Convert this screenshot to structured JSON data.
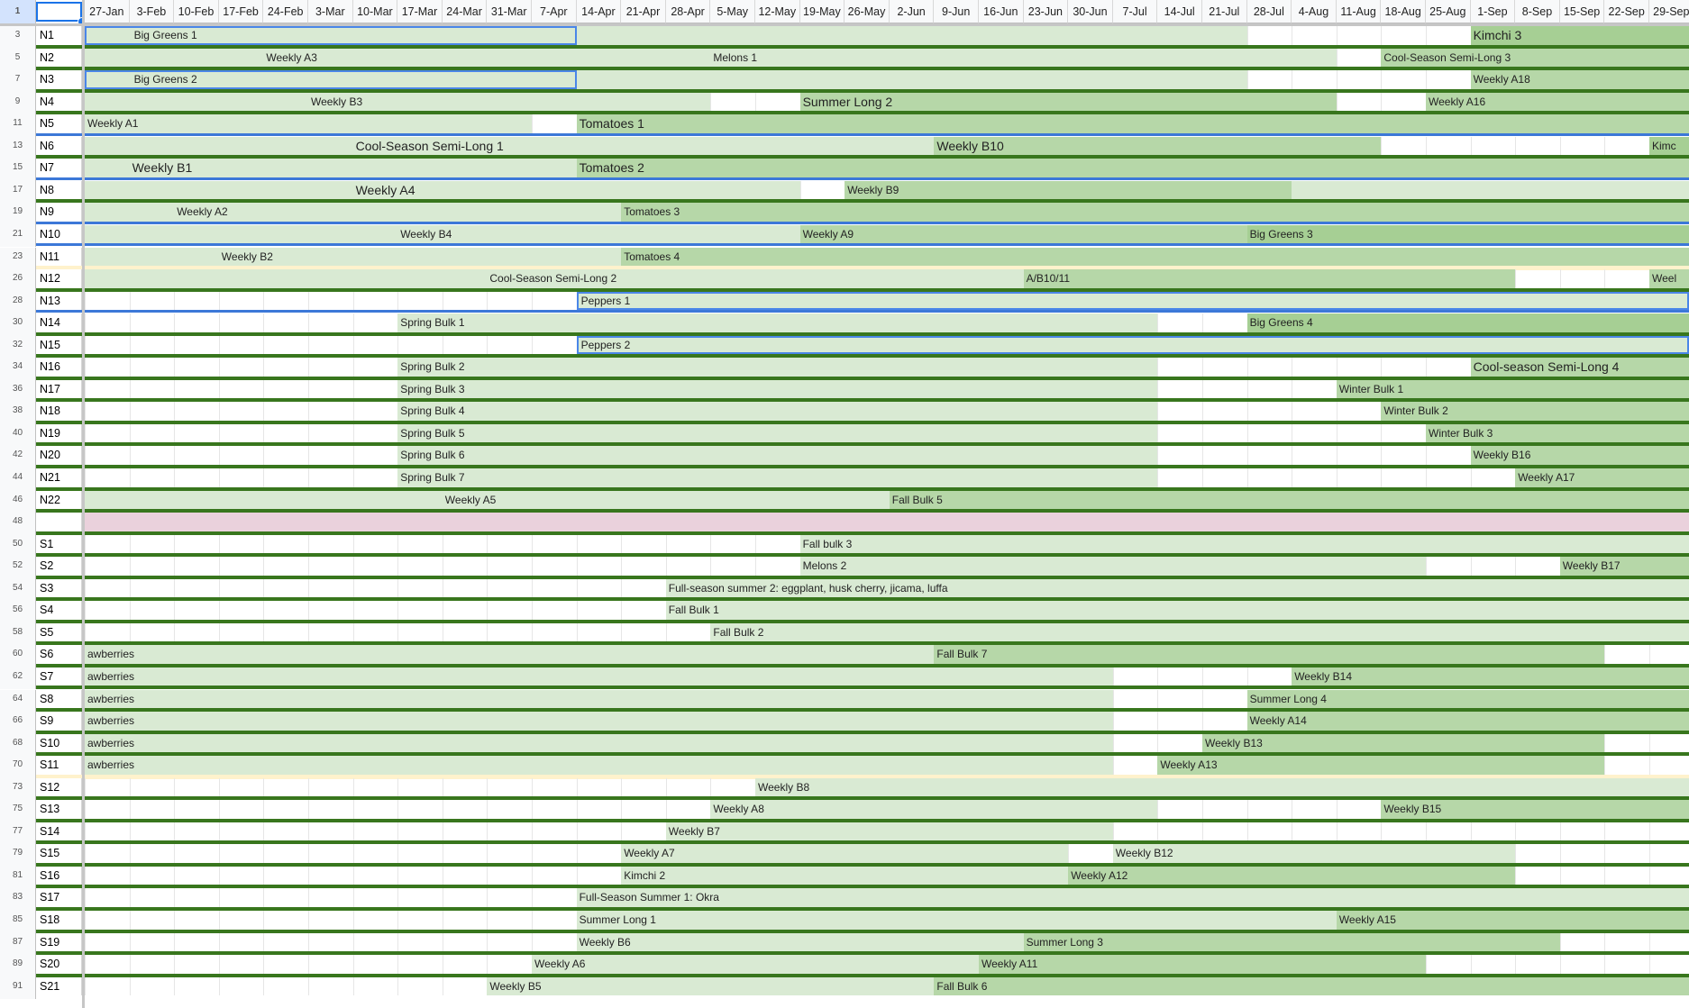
{
  "sheet": {
    "selected_row_number": "1",
    "columns": [
      "27-Jan",
      "3-Feb",
      "10-Feb",
      "17-Feb",
      "24-Feb",
      "3-Mar",
      "10-Mar",
      "17-Mar",
      "24-Mar",
      "31-Mar",
      "7-Apr",
      "14-Apr",
      "21-Apr",
      "28-Apr",
      "5-May",
      "12-May",
      "19-May",
      "26-May",
      "2-Jun",
      "9-Jun",
      "16-Jun",
      "23-Jun",
      "30-Jun",
      "7-Jul",
      "14-Jul",
      "21-Jul",
      "28-Jul",
      "4-Aug",
      "11-Aug",
      "18-Aug",
      "25-Aug",
      "1-Sep",
      "8-Sep",
      "15-Sep",
      "22-Sep",
      "29-Sep"
    ],
    "colors": {
      "light": "#d9ead3",
      "mid": "#b6d7a8",
      "dark": "#a6cf94",
      "separator_green": "#38761d",
      "separator_blue": "#3c78d8",
      "outline_blue": "#4a86e8",
      "pink_row": "#ead1dc",
      "selection_blue": "#1a73e8"
    },
    "rows": [
      {
        "num": "3",
        "label": "N1",
        "sep": "green",
        "segs": [
          {
            "s": 0,
            "e": 11,
            "t": "Big Greens 1",
            "c": "light",
            "o": true,
            "i": 1
          },
          {
            "s": 11,
            "e": 26,
            "t": "",
            "c": "light"
          },
          {
            "s": 31,
            "e": 36,
            "t": "Kimchi 3",
            "c": "dark",
            "big": true
          }
        ]
      },
      {
        "num": "5",
        "label": "N2",
        "sep": "green",
        "segs": [
          {
            "s": 0,
            "e": 14,
            "t": "Weekly A3",
            "c": "light",
            "i": 4
          },
          {
            "s": 14,
            "e": 28,
            "t": "Melons 1",
            "c": "light"
          },
          {
            "s": 29,
            "e": 36,
            "t": "Cool-Season Semi-Long 3",
            "c": "mid"
          }
        ]
      },
      {
        "num": "7",
        "label": "N3",
        "sep": "green",
        "segs": [
          {
            "s": 0,
            "e": 11,
            "t": "Big Greens 2",
            "c": "light",
            "o": true,
            "i": 1
          },
          {
            "s": 11,
            "e": 26,
            "t": "",
            "c": "light"
          },
          {
            "s": 31,
            "e": 36,
            "t": "Weekly A18",
            "c": "mid"
          }
        ]
      },
      {
        "num": "9",
        "label": "N4",
        "sep": "green",
        "segs": [
          {
            "s": 0,
            "e": 14,
            "t": "Weekly B3",
            "c": "light",
            "i": 5
          },
          {
            "s": 16,
            "e": 28,
            "t": "Summer Long 2",
            "c": "mid",
            "big": true
          },
          {
            "s": 30,
            "e": 36,
            "t": "Weekly A16",
            "c": "mid"
          }
        ]
      },
      {
        "num": "11",
        "label": "N5",
        "sep": "blue",
        "segs": [
          {
            "s": 0,
            "e": 10,
            "t": "Weekly A1",
            "c": "light"
          },
          {
            "s": 11,
            "e": 36,
            "t": "Tomatoes 1",
            "c": "mid",
            "big": true
          }
        ]
      },
      {
        "num": "13",
        "label": "N6",
        "sep": "green",
        "segs": [
          {
            "s": 0,
            "e": 19,
            "t": "Cool-Season Semi-Long 1",
            "c": "light",
            "big": true,
            "i": 6
          },
          {
            "s": 19,
            "e": 29,
            "t": "Weekly B10",
            "c": "mid",
            "big": true
          },
          {
            "s": 35,
            "e": 36,
            "t": "Kimc",
            "c": "dark"
          }
        ]
      },
      {
        "num": "15",
        "label": "N7",
        "sep": "blue",
        "segs": [
          {
            "s": 0,
            "e": 11,
            "t": "Weekly B1",
            "c": "light",
            "big": true,
            "i": 1
          },
          {
            "s": 11,
            "e": 36,
            "t": "Tomatoes 2",
            "c": "mid",
            "big": true
          }
        ]
      },
      {
        "num": "17",
        "label": "N8",
        "sep": "green",
        "segs": [
          {
            "s": 0,
            "e": 16,
            "t": "Weekly A4",
            "c": "light",
            "big": true,
            "i": 6
          },
          {
            "s": 17,
            "e": 27,
            "t": "Weekly B9",
            "c": "mid"
          },
          {
            "s": 27,
            "e": 36,
            "t": "",
            "c": "light"
          }
        ]
      },
      {
        "num": "19",
        "label": "N9",
        "sep": "blue",
        "segs": [
          {
            "s": 0,
            "e": 12,
            "t": "Weekly A2",
            "c": "light",
            "i": 2
          },
          {
            "s": 12,
            "e": 36,
            "t": "Tomatoes 3",
            "c": "mid"
          }
        ]
      },
      {
        "num": "21",
        "label": "N10",
        "sep": "blue",
        "segs": [
          {
            "s": 0,
            "e": 16,
            "t": "Weekly B4",
            "c": "light",
            "i": 7
          },
          {
            "s": 16,
            "e": 26,
            "t": "Weekly A9",
            "c": "mid"
          },
          {
            "s": 26,
            "e": 36,
            "t": "Big Greens 3",
            "c": "dark"
          }
        ]
      },
      {
        "num": "23",
        "label": "N11",
        "sep": "thin",
        "segs": [
          {
            "s": 0,
            "e": 12,
            "t": "Weekly B2",
            "c": "light",
            "i": 3
          },
          {
            "s": 12,
            "e": 36,
            "t": "Tomatoes 4",
            "c": "mid"
          }
        ]
      },
      {
        "num": "26",
        "label": "N12",
        "sep": "green",
        "segs": [
          {
            "s": 0,
            "e": 21,
            "t": "Cool-Season Semi-Long 2",
            "c": "light",
            "i": 9
          },
          {
            "s": 21,
            "e": 32,
            "t": "A/B10/11",
            "c": "mid"
          },
          {
            "s": 35,
            "e": 36,
            "t": "Weel",
            "c": "mid"
          }
        ]
      },
      {
        "num": "28",
        "label": "N13",
        "sep": "blue",
        "segs": [
          {
            "s": 11,
            "e": 36,
            "t": "Peppers 1",
            "c": "light",
            "o": true
          }
        ]
      },
      {
        "num": "30",
        "label": "N14",
        "sep": "green",
        "segs": [
          {
            "s": 7,
            "e": 24,
            "t": "Spring Bulk 1",
            "c": "light"
          },
          {
            "s": 26,
            "e": 36,
            "t": "Big Greens 4",
            "c": "dark"
          }
        ]
      },
      {
        "num": "32",
        "label": "N15",
        "sep": "green",
        "segs": [
          {
            "s": 11,
            "e": 36,
            "t": "Peppers 2",
            "c": "light",
            "o": true
          }
        ]
      },
      {
        "num": "34",
        "label": "N16",
        "sep": "green",
        "segs": [
          {
            "s": 7,
            "e": 24,
            "t": "Spring Bulk 2",
            "c": "light"
          },
          {
            "s": 31,
            "e": 36,
            "t": "Cool-season Semi-Long 4",
            "c": "mid",
            "big": true
          }
        ]
      },
      {
        "num": "36",
        "label": "N17",
        "sep": "green",
        "segs": [
          {
            "s": 7,
            "e": 24,
            "t": "Spring Bulk 3",
            "c": "light"
          },
          {
            "s": 28,
            "e": 36,
            "t": "Winter Bulk 1",
            "c": "mid"
          }
        ]
      },
      {
        "num": "38",
        "label": "N18",
        "sep": "green",
        "segs": [
          {
            "s": 7,
            "e": 24,
            "t": "Spring Bulk 4",
            "c": "light"
          },
          {
            "s": 29,
            "e": 36,
            "t": "Winter Bulk 2",
            "c": "mid"
          }
        ]
      },
      {
        "num": "40",
        "label": "N19",
        "sep": "green",
        "segs": [
          {
            "s": 7,
            "e": 24,
            "t": "Spring Bulk 5",
            "c": "light"
          },
          {
            "s": 30,
            "e": 36,
            "t": "Winter Bulk 3",
            "c": "mid"
          }
        ]
      },
      {
        "num": "42",
        "label": "N20",
        "sep": "green",
        "segs": [
          {
            "s": 7,
            "e": 24,
            "t": "Spring Bulk 6",
            "c": "light"
          },
          {
            "s": 31,
            "e": 36,
            "t": "Weekly B16",
            "c": "mid"
          }
        ]
      },
      {
        "num": "44",
        "label": "N21",
        "sep": "green",
        "segs": [
          {
            "s": 7,
            "e": 24,
            "t": "Spring Bulk 7",
            "c": "light"
          },
          {
            "s": 32,
            "e": 36,
            "t": "Weekly A17",
            "c": "mid"
          }
        ]
      },
      {
        "num": "46",
        "label": "N22",
        "sep": "green",
        "segs": [
          {
            "s": 0,
            "e": 18,
            "t": "Weekly A5",
            "c": "light",
            "i": 8
          },
          {
            "s": 18,
            "e": 36,
            "t": "Fall Bulk 5",
            "c": "mid"
          }
        ]
      },
      {
        "num": "48",
        "label": "",
        "sep": "green",
        "pink": true,
        "segs": []
      },
      {
        "num": "50",
        "label": "S1",
        "sep": "green",
        "segs": [
          {
            "s": 16,
            "e": 36,
            "t": "Fall bulk 3",
            "c": "light"
          }
        ]
      },
      {
        "num": "52",
        "label": "S2",
        "sep": "green",
        "segs": [
          {
            "s": 16,
            "e": 30,
            "t": "Melons 2",
            "c": "light"
          },
          {
            "s": 33,
            "e": 36,
            "t": "Weekly B17",
            "c": "mid"
          }
        ]
      },
      {
        "num": "54",
        "label": "S3",
        "sep": "green",
        "segs": [
          {
            "s": 13,
            "e": 36,
            "t": "Full-season summer 2: eggplant, husk cherry, jicama, luffa",
            "c": "light"
          }
        ]
      },
      {
        "num": "56",
        "label": "S4",
        "sep": "green",
        "segs": [
          {
            "s": 13,
            "e": 36,
            "t": "Fall Bulk 1",
            "c": "light"
          }
        ]
      },
      {
        "num": "58",
        "label": "S5",
        "sep": "green",
        "segs": [
          {
            "s": 14,
            "e": 36,
            "t": "Fall Bulk 2",
            "c": "light"
          }
        ]
      },
      {
        "num": "60",
        "label": "S6",
        "sep": "green",
        "segs": [
          {
            "s": 0,
            "e": 19,
            "t": "awberries",
            "c": "light"
          },
          {
            "s": 19,
            "e": 34,
            "t": "Fall Bulk 7",
            "c": "mid"
          }
        ]
      },
      {
        "num": "62",
        "label": "S7",
        "sep": "green",
        "segs": [
          {
            "s": 0,
            "e": 23,
            "t": "awberries",
            "c": "light"
          },
          {
            "s": 27,
            "e": 36,
            "t": "Weekly B14",
            "c": "mid"
          }
        ]
      },
      {
        "num": "64",
        "label": "S8",
        "sep": "green",
        "segs": [
          {
            "s": 0,
            "e": 23,
            "t": "awberries",
            "c": "light"
          },
          {
            "s": 26,
            "e": 36,
            "t": "Summer Long 4",
            "c": "mid"
          }
        ]
      },
      {
        "num": "66",
        "label": "S9",
        "sep": "green",
        "segs": [
          {
            "s": 0,
            "e": 23,
            "t": "awberries",
            "c": "light"
          },
          {
            "s": 26,
            "e": 36,
            "t": "Weekly A14",
            "c": "mid"
          }
        ]
      },
      {
        "num": "68",
        "label": "S10",
        "sep": "green",
        "segs": [
          {
            "s": 0,
            "e": 23,
            "t": "awberries",
            "c": "light"
          },
          {
            "s": 25,
            "e": 34,
            "t": "Weekly B13",
            "c": "mid"
          }
        ]
      },
      {
        "num": "70",
        "label": "S11",
        "sep": "thin",
        "segs": [
          {
            "s": 0,
            "e": 23,
            "t": "awberries",
            "c": "light"
          },
          {
            "s": 24,
            "e": 34,
            "t": "Weekly A13",
            "c": "mid"
          }
        ]
      },
      {
        "num": "73",
        "label": "S12",
        "sep": "green",
        "segs": [
          {
            "s": 15,
            "e": 36,
            "t": "Weekly B8",
            "c": "light"
          }
        ]
      },
      {
        "num": "75",
        "label": "S13",
        "sep": "green",
        "segs": [
          {
            "s": 14,
            "e": 24,
            "t": "Weekly A8",
            "c": "light"
          },
          {
            "s": 29,
            "e": 36,
            "t": "Weekly B15",
            "c": "mid"
          }
        ]
      },
      {
        "num": "77",
        "label": "S14",
        "sep": "green",
        "segs": [
          {
            "s": 13,
            "e": 23,
            "t": "Weekly B7",
            "c": "light"
          }
        ]
      },
      {
        "num": "79",
        "label": "S15",
        "sep": "green",
        "segs": [
          {
            "s": 12,
            "e": 22,
            "t": "Weekly A7",
            "c": "light"
          },
          {
            "s": 23,
            "e": 32,
            "t": "Weekly B12",
            "c": "light"
          }
        ]
      },
      {
        "num": "81",
        "label": "S16",
        "sep": "green",
        "segs": [
          {
            "s": 12,
            "e": 22,
            "t": "Kimchi 2",
            "c": "light"
          },
          {
            "s": 22,
            "e": 32,
            "t": "Weekly A12",
            "c": "mid"
          }
        ]
      },
      {
        "num": "83",
        "label": "S17",
        "sep": "green",
        "segs": [
          {
            "s": 11,
            "e": 36,
            "t": "Full-Season Summer 1: Okra",
            "c": "light"
          }
        ]
      },
      {
        "num": "85",
        "label": "S18",
        "sep": "green",
        "segs": [
          {
            "s": 11,
            "e": 28,
            "t": "Summer Long 1",
            "c": "light"
          },
          {
            "s": 28,
            "e": 36,
            "t": "Weekly A15",
            "c": "mid"
          }
        ]
      },
      {
        "num": "87",
        "label": "S19",
        "sep": "green",
        "segs": [
          {
            "s": 11,
            "e": 21,
            "t": "Weekly B6",
            "c": "light"
          },
          {
            "s": 21,
            "e": 33,
            "t": "Summer Long 3",
            "c": "mid"
          }
        ]
      },
      {
        "num": "89",
        "label": "S20",
        "sep": "green",
        "segs": [
          {
            "s": 10,
            "e": 20,
            "t": "Weekly A6",
            "c": "light"
          },
          {
            "s": 20,
            "e": 30,
            "t": "Weekly A11",
            "c": "mid"
          }
        ]
      },
      {
        "num": "91",
        "label": "S21",
        "sep": "none",
        "segs": [
          {
            "s": 9,
            "e": 19,
            "t": "Weekly B5",
            "c": "light"
          },
          {
            "s": 19,
            "e": 36,
            "t": "Fall Bulk 6",
            "c": "mid"
          }
        ]
      }
    ]
  }
}
